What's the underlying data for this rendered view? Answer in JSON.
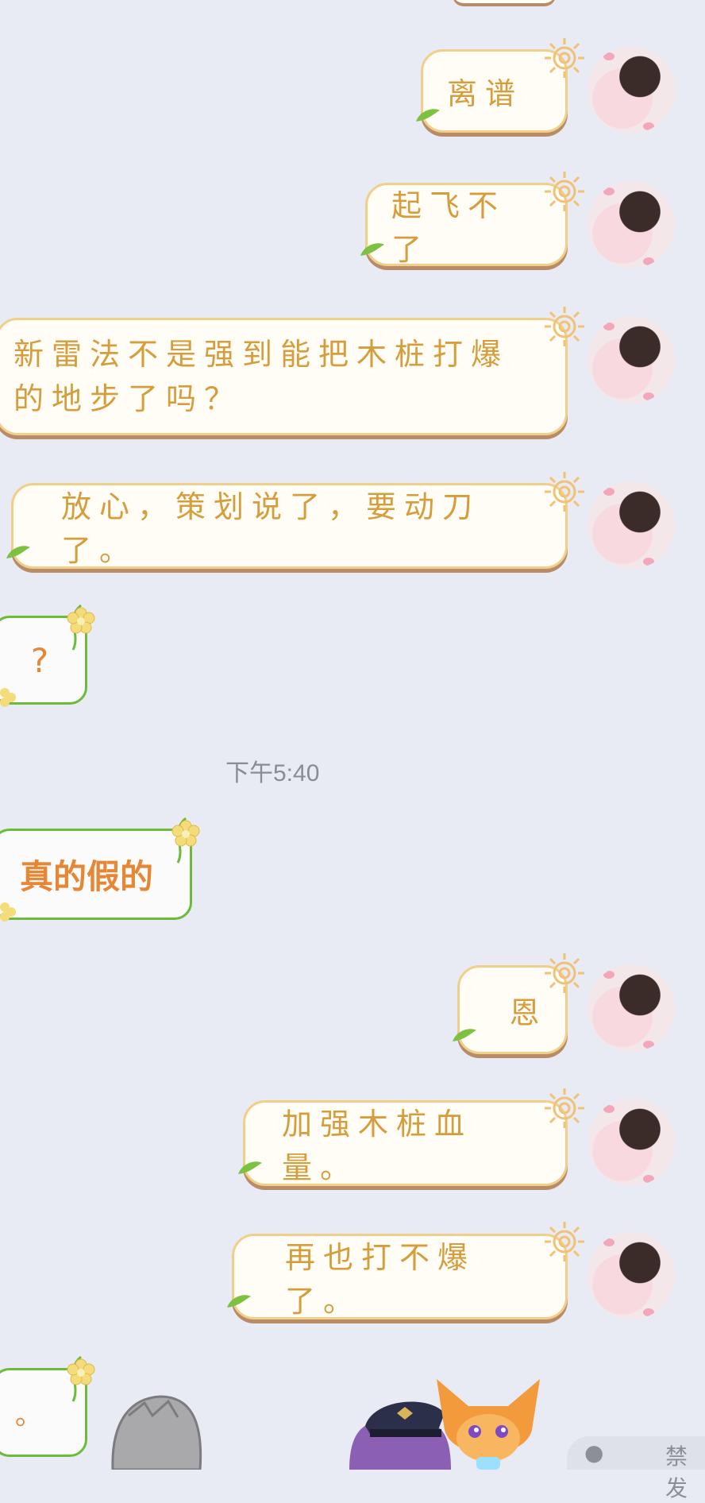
{
  "messages_out": [
    {
      "text": "离谱"
    },
    {
      "text": "起飞不了"
    },
    {
      "text": "新雷法不是强到能把木桩打爆的地步了吗？"
    },
    {
      "text": "放心，策划说了，要动刀了。"
    },
    {
      "text": "恩"
    },
    {
      "text": "加强木桩血量。"
    },
    {
      "text": "再也打不爆了。"
    }
  ],
  "messages_in": [
    {
      "text": "?"
    },
    {
      "text": "真的假的"
    },
    {
      "text": "。"
    }
  ],
  "timestamp": "下午5:40",
  "input": {
    "placeholder": "禁发"
  },
  "colors": {
    "background": "#e9ebf4",
    "out_text": "#d59d3b",
    "out_border": "#f0cf8a",
    "in_text": "#e58734",
    "in_border": "#6dbb3a"
  },
  "icons": [
    "sun-icon",
    "leaf-icon",
    "flower-icon",
    "avatar",
    "paw-icon"
  ]
}
